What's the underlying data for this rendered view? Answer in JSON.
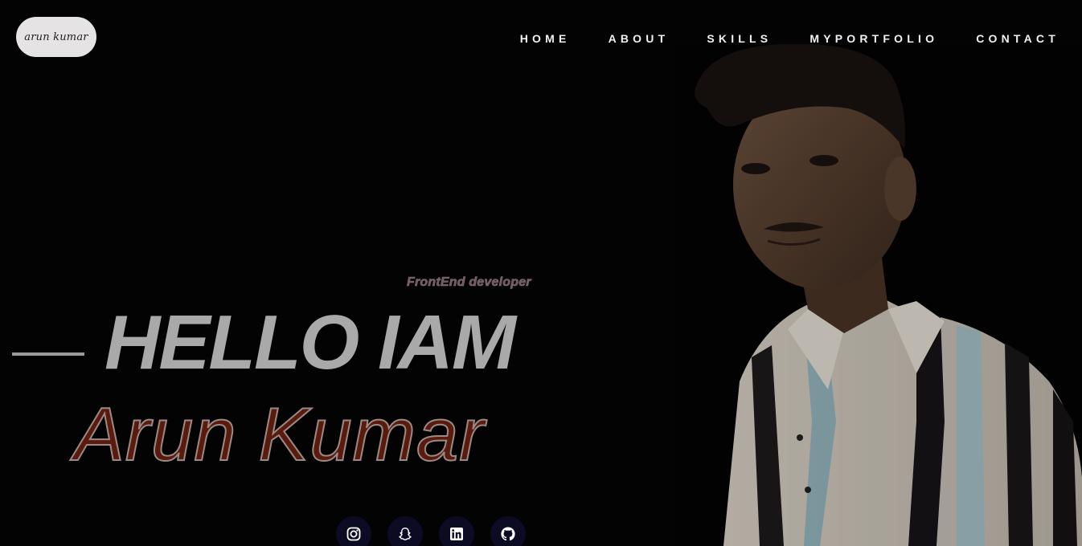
{
  "logo": {
    "text": "arun kumar"
  },
  "nav": {
    "items": [
      "HOME",
      "ABOUT",
      "SKILLS",
      "MYPORTFOLIO",
      "CONTACT"
    ]
  },
  "hero": {
    "subtitle": "FrontEnd developer",
    "greeting": "HELLO IAM",
    "name": "Arun Kumar"
  },
  "socials": {
    "icons": [
      "instagram-icon",
      "snapchat-icon",
      "linkedin-icon",
      "github-icon"
    ]
  },
  "colors": {
    "background": "#040303",
    "greeting": "#a9a9a9",
    "name_fill": "#5a1a0d",
    "social_bg": "#0c0b24"
  }
}
